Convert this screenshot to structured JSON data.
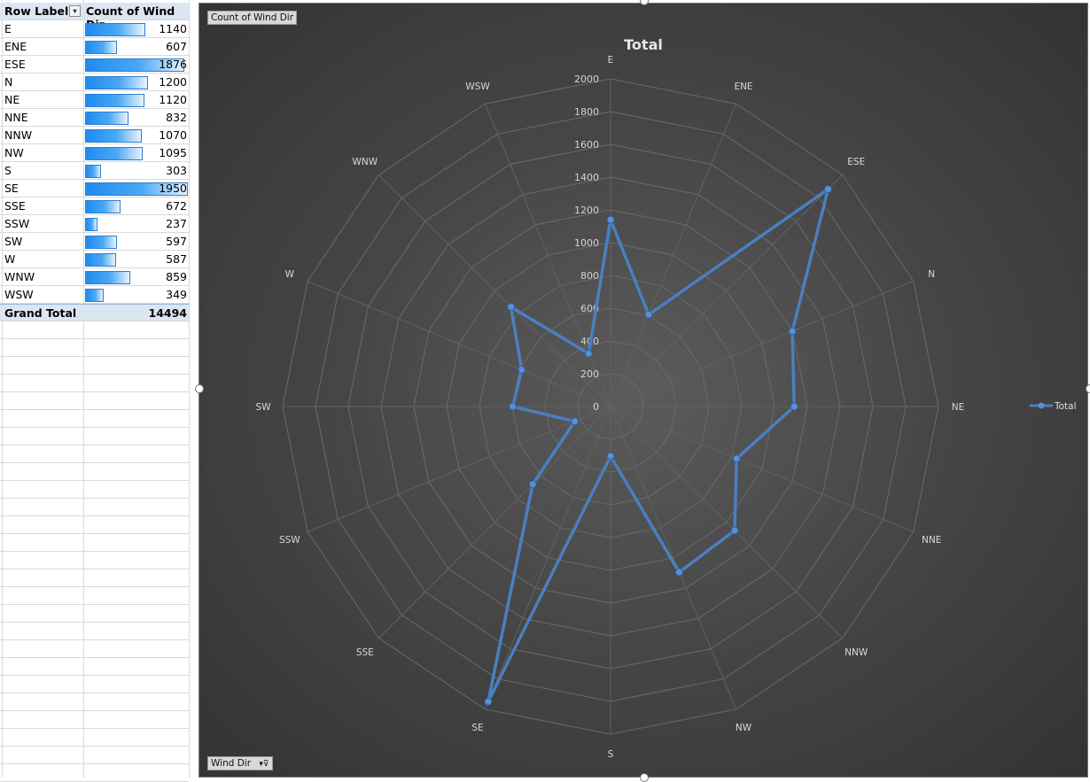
{
  "pivot": {
    "header": {
      "row_labels": "Row Labels",
      "count_label": "Count of Wind Dir"
    },
    "rows": [
      {
        "label": "E",
        "value": "1140",
        "num": 1140
      },
      {
        "label": "ENE",
        "value": "607",
        "num": 607
      },
      {
        "label": "ESE",
        "value": "1876",
        "num": 1876
      },
      {
        "label": "N",
        "value": "1200",
        "num": 1200
      },
      {
        "label": "NE",
        "value": "1120",
        "num": 1120
      },
      {
        "label": "NNE",
        "value": "832",
        "num": 832
      },
      {
        "label": "NNW",
        "value": "1070",
        "num": 1070
      },
      {
        "label": "NW",
        "value": "1095",
        "num": 1095
      },
      {
        "label": "S",
        "value": "303",
        "num": 303
      },
      {
        "label": "SE",
        "value": "1950",
        "num": 1950
      },
      {
        "label": "SSE",
        "value": "672",
        "num": 672
      },
      {
        "label": "SSW",
        "value": "237",
        "num": 237
      },
      {
        "label": "SW",
        "value": "597",
        "num": 597
      },
      {
        "label": "W",
        "value": "587",
        "num": 587
      },
      {
        "label": "WNW",
        "value": "859",
        "num": 859
      },
      {
        "label": "WSW",
        "value": "349",
        "num": 349
      }
    ],
    "grand_total": {
      "label": "Grand Total",
      "value": "14494"
    },
    "databar_color": "#1e8bf0"
  },
  "chart_buttons": {
    "value_field": "Count of Wind Dir",
    "axis_field": "Wind Dir"
  },
  "chart_data": {
    "type": "radar",
    "title": "Total",
    "categories": [
      "E",
      "ENE",
      "ESE",
      "N",
      "NE",
      "NNE",
      "NNW",
      "NW",
      "S",
      "SE",
      "SSE",
      "SSW",
      "SW",
      "W",
      "WNW",
      "WSW"
    ],
    "series": [
      {
        "name": "Total",
        "values": [
          1140,
          607,
          1876,
          1200,
          1120,
          832,
          1070,
          1095,
          303,
          1950,
          672,
          237,
          597,
          587,
          859,
          349
        ]
      }
    ],
    "radial_ticks": [
      "0",
      "200",
      "400",
      "600",
      "800",
      "1000",
      "1200",
      "1400",
      "1600",
      "1800",
      "2000"
    ],
    "rmax": 2000,
    "legend": "right",
    "series_color": "#4a7fc1",
    "background": "#474747"
  }
}
